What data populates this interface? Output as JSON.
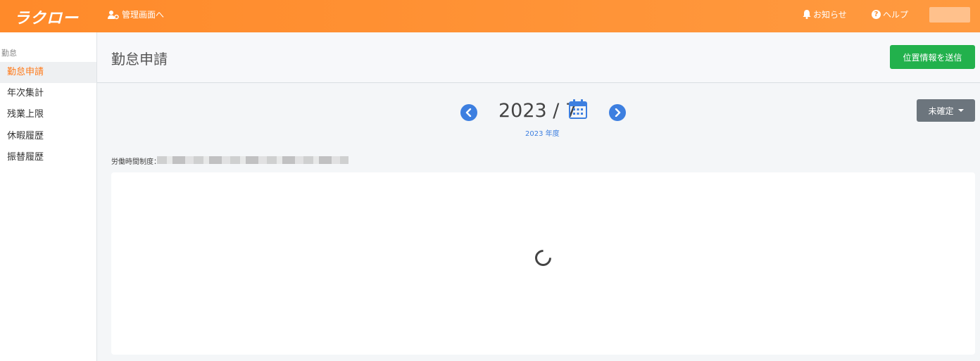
{
  "header": {
    "logo": "ラクロー",
    "admin_link": "管理画面へ",
    "notice": "お知らせ",
    "help": "ヘルプ"
  },
  "sidebar": {
    "group": "勤怠",
    "items": [
      {
        "label": "勤怠申請",
        "active": true
      },
      {
        "label": "年次集計",
        "active": false
      },
      {
        "label": "残業上限",
        "active": false
      },
      {
        "label": "休暇履歴",
        "active": false
      },
      {
        "label": "振替履歴",
        "active": false
      }
    ]
  },
  "page": {
    "title": "勤怠申請",
    "geo_button": "位置情報を送信",
    "month": "2023 / 7",
    "fiscal_year": "2023 年度",
    "status": "未確定",
    "work_system_label": "労働時間制度："
  },
  "colors": {
    "brand": "#ff8a2a",
    "accent_blue": "#3d7fe0",
    "success": "#22b14c",
    "secondary": "#6c757d"
  }
}
